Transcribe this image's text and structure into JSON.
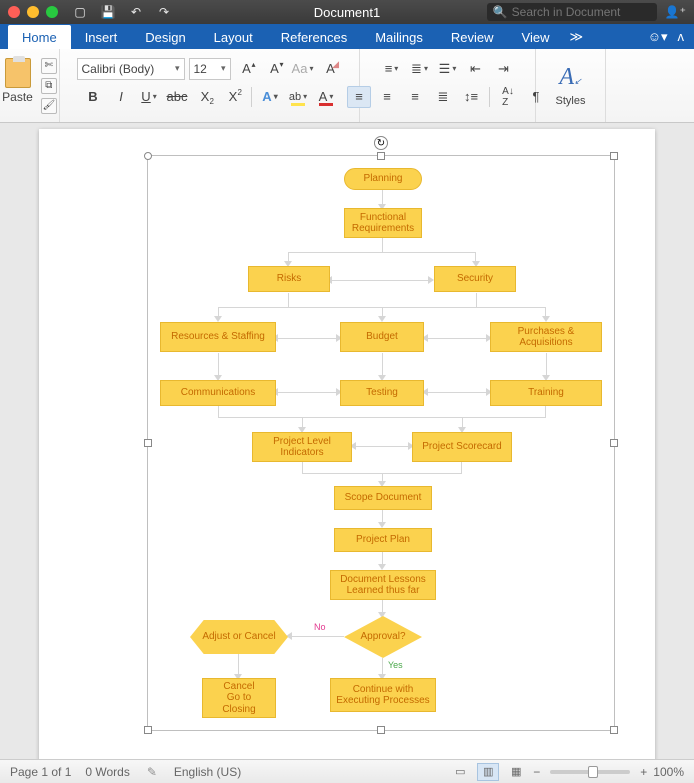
{
  "titlebar": {
    "document_name": "Document1"
  },
  "search": {
    "placeholder": "Search in Document"
  },
  "tabs": {
    "home": "Home",
    "insert": "Insert",
    "design": "Design",
    "layout": "Layout",
    "references": "References",
    "mailings": "Mailings",
    "review": "Review",
    "view": "View",
    "more": "≫"
  },
  "ribbon": {
    "paste_label": "Paste",
    "font_name": "Calibri (Body)",
    "font_size": "12",
    "styles_label": "Styles"
  },
  "flowchart": {
    "planning": "Planning",
    "functional": "Functional\nRequirements",
    "risks": "Risks",
    "security": "Security",
    "resources": "Resources & Staffing",
    "budget": "Budget",
    "purchases": "Purchases &\nAcquisitions",
    "communications": "Communications",
    "testing": "Testing",
    "training": "Training",
    "indicators": "Project Level\nIndicators",
    "scorecard": "Project Scorecard",
    "scope": "Scope Document",
    "plan": "Project Plan",
    "lessons": "Document Lessons\nLearned thus far",
    "approval": "Approval?",
    "adjust": "Adjust or Cancel",
    "cancel": "Cancel\nGo to\nClosing",
    "continue": "Continue with\nExecuting Processes",
    "no": "No",
    "yes": "Yes"
  },
  "statusbar": {
    "page": "Page 1 of 1",
    "words": "0 Words",
    "lang": "English (US)",
    "zoom": "100%"
  }
}
